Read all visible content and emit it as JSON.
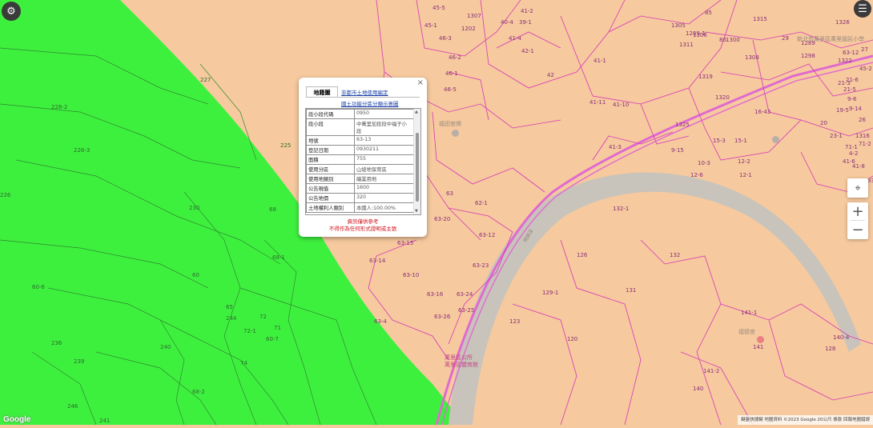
{
  "toolbar": {
    "settings_icon": "gear-icon",
    "menu_icon": "hamburger-icon",
    "locate_icon": "crosshair-icon",
    "zoom_in": "+",
    "zoom_out": "−"
  },
  "colors": {
    "green_zone": "#3ef03e",
    "land_zone": "#f6c99e",
    "parcel_line": "#d63ab8",
    "road": "#e06ad0",
    "river": "#c8c4bb"
  },
  "popup": {
    "close": "×",
    "tab_active": "地籍圖",
    "links": [
      "非都市土地使用編定",
      "國土功能分區分類示意圖"
    ],
    "rows": [
      {
        "key": "段小段代碼",
        "value": "0950"
      },
      {
        "key": "段小段",
        "value": "中萬里加投段中福子小段"
      },
      {
        "key": "地號",
        "value": "63-13"
      },
      {
        "key": "登記日期",
        "value": "0930211"
      },
      {
        "key": "面積",
        "value": "755"
      },
      {
        "key": "使用分區",
        "value": "山坡地保育區"
      },
      {
        "key": "使用地類別",
        "value": "礦業用地"
      },
      {
        "key": "公告現值",
        "value": "1600"
      },
      {
        "key": "公告地價",
        "value": "320"
      },
      {
        "key": "土地權利人類別",
        "value": "本國人:100.00%"
      }
    ],
    "note_line1": "資訊僅供參考",
    "note_line2": "不得作為任何形式證明或主張"
  },
  "map_labels": {
    "green": [
      "227",
      "228-2",
      "226-3",
      "226",
      "230",
      "225",
      "68",
      "68-1",
      "60",
      "60-6",
      "236",
      "239",
      "240",
      "246",
      "241",
      "244",
      "72",
      "72-1",
      "71",
      "65",
      "74",
      "60-7",
      "68-2"
    ],
    "land": [
      "45-1",
      "45-5",
      "46-3",
      "46-2",
      "46-1",
      "46-5",
      "41-2",
      "40-4",
      "42-1",
      "39-1",
      "41-4",
      "41-1",
      "41-10",
      "41-11",
      "41-3",
      "42",
      "1305",
      "1306",
      "1300",
      "1308",
      "1311",
      "1319",
      "1325",
      "1320",
      "1289",
      "1298",
      "16-43",
      "15-3",
      "15-1",
      "12-2",
      "12-6",
      "10-3",
      "12-1",
      "9-15",
      "63",
      "62-1",
      "63-20",
      "63-12",
      "63-15",
      "63-14",
      "63-10",
      "63-23",
      "63-26",
      "63-24",
      "63-25",
      "63-16",
      "63-4",
      "132-1",
      "126",
      "132",
      "131",
      "129-1",
      "123",
      "120",
      "141-1",
      "141",
      "141-2",
      "140",
      "140-4",
      "128",
      "29",
      "21-3",
      "21-6",
      "21-5",
      "4-2",
      "41-6",
      "41-8",
      "1293",
      "1315",
      "1289-1",
      "9-6",
      "9-14",
      "85",
      "86",
      "1202",
      "1307",
      "45-2",
      "27",
      "26",
      "1322",
      "1326",
      "1316",
      "71-1",
      "71-2",
      "23-1",
      "19-5",
      "20",
      "21-9",
      "63-12"
    ]
  },
  "places": [
    "福田宮牌",
    "萬里區名所",
    "萬里區公所",
    "萬里區體育館",
    "新北市萬里區萬里國民小學",
    "瑪鍊溪",
    "福德宮"
  ],
  "branding": {
    "google": "Google",
    "attribution": "鍵盤快捷鍵  地圖資料 ©2023 Google  20公尺  條款  回報地圖錯誤"
  }
}
